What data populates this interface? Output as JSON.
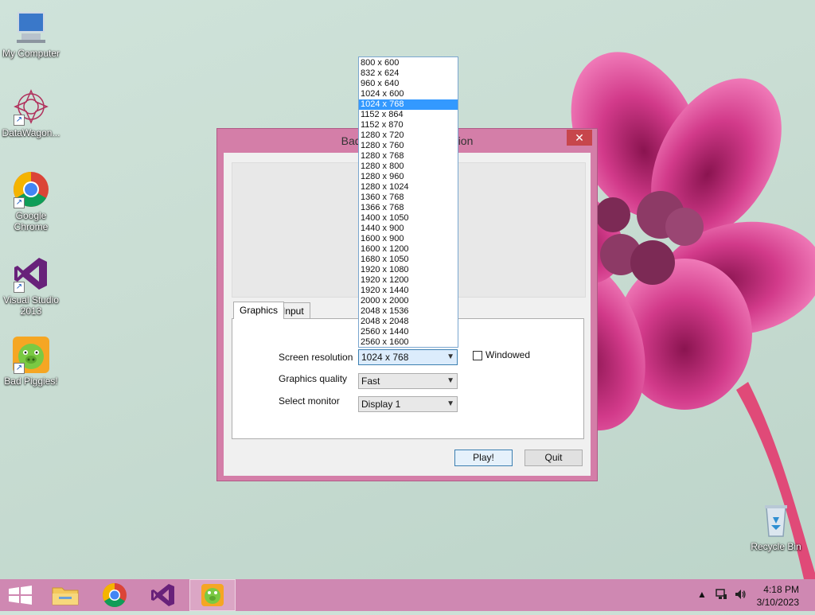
{
  "desktop": {
    "icons": [
      {
        "label": "My Computer"
      },
      {
        "label": "DataWagon..."
      },
      {
        "label": "Google Chrome"
      },
      {
        "label": "Visual Studio 2013"
      },
      {
        "label": "Bad Piggies!"
      },
      {
        "label": "Recycle Bin"
      }
    ]
  },
  "launcher": {
    "title": "Bad Piggies! Configuration",
    "close_label": "✕",
    "tabs": [
      {
        "label": "Graphics"
      },
      {
        "label": "Input"
      }
    ],
    "screen_resolution_label": "Screen resolution",
    "screen_resolution_value": "1024 x 768",
    "windowed_label": "Windowed",
    "graphics_quality_label": "Graphics quality",
    "graphics_quality_value": "Fast",
    "select_monitor_label": "Select monitor",
    "select_monitor_value": "Display 1",
    "play_label": "Play!",
    "quit_label": "Quit"
  },
  "resolution_options": [
    "800 x 600",
    "832 x 624",
    "960 x 640",
    "1024 x 600",
    "1024 x 768",
    "1152 x 864",
    "1152 x 870",
    "1280 x 720",
    "1280 x 760",
    "1280 x 768",
    "1280 x 800",
    "1280 x 960",
    "1280 x 1024",
    "1360 x 768",
    "1366 x 768",
    "1400 x 1050",
    "1440 x 900",
    "1600 x 900",
    "1600 x 1200",
    "1680 x 1050",
    "1920 x 1080",
    "1920 x 1200",
    "1920 x 1440",
    "2000 x 2000",
    "2048 x 1536",
    "2048 x 2048",
    "2560 x 1440",
    "2560 x 1600"
  ],
  "selected_resolution_index": 4,
  "taskbar": {
    "time": "4:18 PM",
    "date": "3/10/2023"
  },
  "colors": {
    "accent": "#cf88b2",
    "selection": "#3399ff",
    "close": "#c7464c"
  }
}
